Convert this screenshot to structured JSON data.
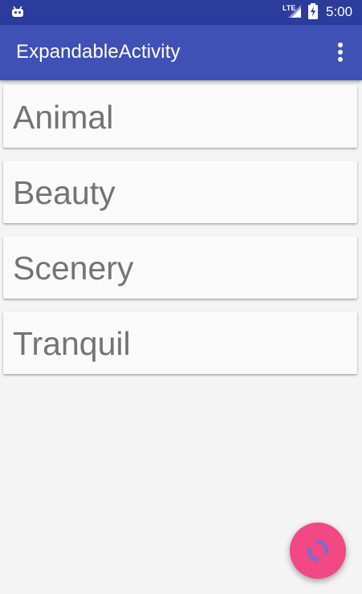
{
  "status_bar": {
    "network": "LTE",
    "time": "5:00",
    "icons": [
      "android-icon",
      "signal-icon",
      "battery-charging-icon"
    ]
  },
  "app_bar": {
    "title": "ExpandableActivity",
    "menu_icon": "more-vert-icon"
  },
  "list": {
    "items": [
      {
        "label": "Animal"
      },
      {
        "label": "Beauty"
      },
      {
        "label": "Scenery"
      },
      {
        "label": "Tranquil"
      }
    ]
  },
  "fab": {
    "icon": "refresh-icon"
  },
  "colors": {
    "status_bar": "#2b3c9c",
    "app_bar": "#3f51b5",
    "background": "#f4f4f4",
    "card": "#fafafa",
    "text": "#737373",
    "fab": "#f24883",
    "fab_icon": "#6f6fd8"
  }
}
